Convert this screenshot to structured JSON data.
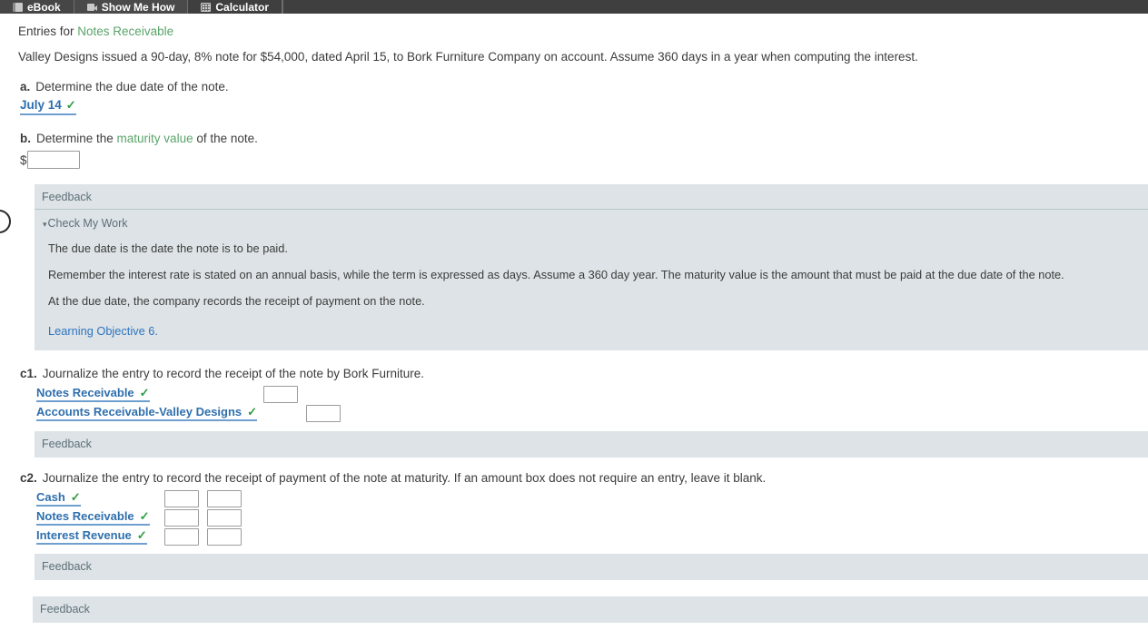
{
  "toolbar": {
    "tabs": [
      {
        "label": "eBook",
        "icon": "book-icon"
      },
      {
        "label": "Show Me How",
        "icon": "video-icon"
      },
      {
        "label": "Calculator",
        "icon": "calculator-icon"
      }
    ]
  },
  "page": {
    "title_prefix": "Entries for ",
    "title_term": "Notes Receivable",
    "intro": "Valley Designs issued a 90-day, 8% note for $54,000, dated April 15, to Bork Furniture Company on account. Assume 360 days in a year when computing the interest."
  },
  "parts": {
    "a": {
      "label": "a.",
      "prompt": "Determine the due date of the note.",
      "answer": "July 14",
      "check": "✓"
    },
    "b": {
      "label": "b.",
      "prompt_before": "Determine the ",
      "prompt_term": "maturity value",
      "prompt_after": " of the note.",
      "currency": "$",
      "value": "",
      "placeholder": ""
    },
    "c1": {
      "label": "c1.",
      "prompt": "Journalize the entry to record the receipt of the note by Bork Furniture.",
      "rows": [
        {
          "account": "Notes Receivable",
          "check": "✓",
          "debit": "",
          "credit": null
        },
        {
          "account": "Accounts Receivable-Valley Designs",
          "check": "✓",
          "debit": null,
          "credit": ""
        }
      ],
      "feedback_label": "Feedback"
    },
    "c2": {
      "label": "c2.",
      "prompt": "Journalize the entry to record the receipt of payment of the note at maturity. If an amount box does not require an entry, leave it blank.",
      "rows": [
        {
          "account": "Cash",
          "check": "✓",
          "debit": "",
          "credit": ""
        },
        {
          "account": "Notes Receivable",
          "check": "✓",
          "debit": "",
          "credit": ""
        },
        {
          "account": "Interest Revenue",
          "check": "✓",
          "debit": "",
          "credit": ""
        }
      ],
      "feedback_label": "Feedback"
    }
  },
  "feedback": {
    "header": "Feedback",
    "toggle_caret": "▾",
    "toggle_label": "Check My Work",
    "line1": "The due date is the date the note is to be paid.",
    "line2": "Remember the interest rate is stated on an annual basis, while the term is expressed as days. Assume a 360 day year. The maturity value is the amount that must be paid at the due date of the note.",
    "line3": "At the due date, the company records the receipt of payment on the note.",
    "objective_link": "Learning Objective 6."
  },
  "bottom": {
    "feedback_label": "Feedback"
  },
  "colors": {
    "glossary_green": "#5aa469",
    "link_blue": "#2f6fad",
    "check_green": "#2e9b43",
    "feedback_bg": "#dde3e6",
    "toolbar_bg": "#3f3f3f"
  }
}
